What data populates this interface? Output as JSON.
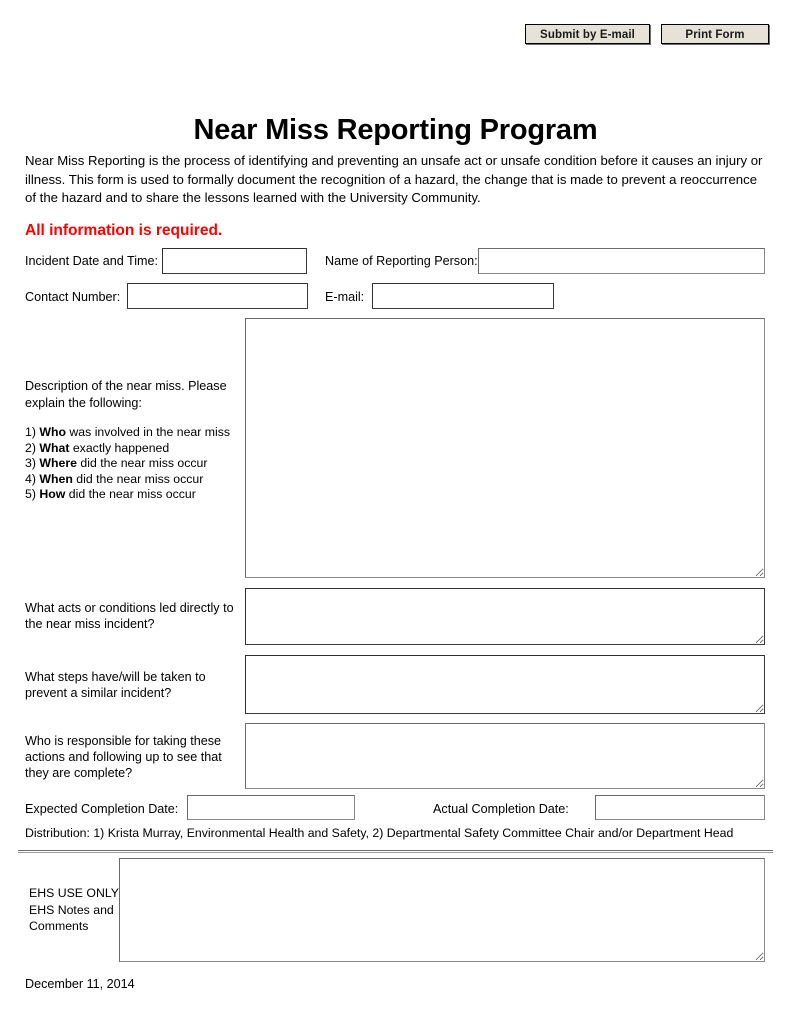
{
  "toolbar": {
    "submit_label": "Submit by E-mail",
    "print_label": "Print Form"
  },
  "header": {
    "title": "Near Miss Reporting Program",
    "intro": "Near Miss Reporting is the process of identifying and preventing an unsafe act or unsafe condition before it causes an injury or illness.  This form is used to formally document the recognition of a hazard, the change that is made to prevent a reoccurrence of the hazard and to share the lessons learned with the University Community.",
    "required_note": "All information is required.",
    "required_color": "#fe0000"
  },
  "fields": {
    "incident_datetime": {
      "label": "Incident Date and Time:",
      "value": "",
      "placeholder": ""
    },
    "reporting_person": {
      "label": "Name of Reporting Person:",
      "value": "",
      "placeholder": ""
    },
    "contact_number": {
      "label": "Contact Number:",
      "value": "",
      "placeholder": ""
    },
    "email": {
      "label": "E-mail:",
      "value": "",
      "placeholder": ""
    },
    "description": {
      "label_intro": "Description of the near miss.  Please explain the following:",
      "items": [
        {
          "num": "1)",
          "keyword": "Who",
          "rest": "was involved in the near miss"
        },
        {
          "num": "2)",
          "keyword": "What",
          "rest": "exactly happened"
        },
        {
          "num": "3)",
          "keyword": "Where",
          "rest": "did the near miss occur"
        },
        {
          "num": "4)",
          "keyword": "When",
          "rest": "did the near miss occur"
        },
        {
          "num": "5)",
          "keyword": "How",
          "rest": "did the near miss occur"
        }
      ],
      "value": "",
      "placeholder": ""
    },
    "acts_conditions": {
      "label": "What acts or conditions led directly to the near miss incident?",
      "value": "",
      "placeholder": ""
    },
    "steps_taken": {
      "label": "What steps have/will be taken to prevent a similar incident?",
      "value": "",
      "placeholder": ""
    },
    "responsible_party": {
      "label": "Who is responsible for taking these actions and following up to see that they are complete?",
      "value": "",
      "placeholder": ""
    },
    "expected_completion": {
      "label": "Expected Completion Date:",
      "value": "",
      "placeholder": ""
    },
    "actual_completion": {
      "label": "Actual Completion Date:",
      "value": "",
      "placeholder": ""
    }
  },
  "distribution": "Distribution:  1) Krista Murray, Environmental Health and Safety, 2) Departmental Safety Committee Chair and/or Department Head",
  "ehs_section": {
    "label": "EHS USE ONLY EHS Notes and Comments",
    "label_lines": [
      "EHS USE ONLY",
      "EHS Notes and",
      "Comments"
    ],
    "value": "",
    "placeholder": ""
  },
  "footer": {
    "doc_date": "December 11, 2014"
  }
}
